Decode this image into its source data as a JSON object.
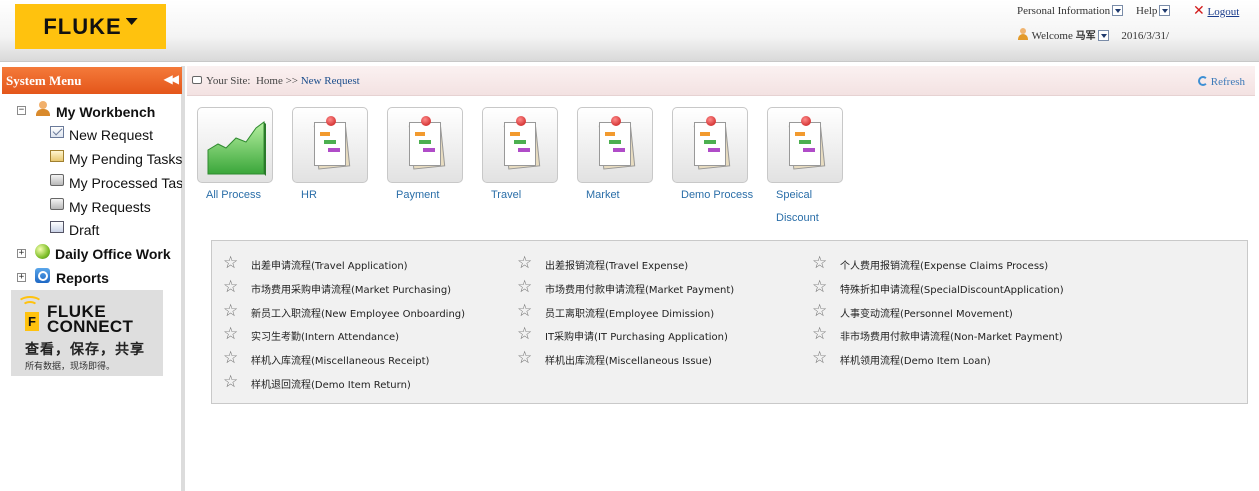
{
  "header": {
    "logo_text": "FLUKE",
    "personal_info": "Personal Information",
    "help": "Help",
    "logout": "Logout",
    "welcome": "Welcome",
    "username": "马军",
    "date": "2016/3/31/"
  },
  "sidebar": {
    "title": "System Menu",
    "tree": [
      {
        "label": "My Workbench",
        "expanded": true,
        "children": [
          {
            "label": "New Request"
          },
          {
            "label": "My Pending Tasks"
          },
          {
            "label": "My Processed Tasks"
          },
          {
            "label": "My Requests"
          },
          {
            "label": "Draft"
          }
        ]
      },
      {
        "label": "Daily Office Work",
        "expanded": false
      },
      {
        "label": "Reports",
        "expanded": false
      }
    ],
    "toggle_expanded": "−",
    "toggle_collapsed": "+",
    "ad": {
      "line1": "FLUKE",
      "line2": "CONNECT",
      "slogan": "查看，保存，共享",
      "subtext": "所有数据，现场即得。",
      "badge": "F"
    }
  },
  "breadcrumb": {
    "prefix": "Your Site:",
    "home": "Home >>",
    "current": "New Request",
    "refresh": "Refresh"
  },
  "tiles": [
    {
      "label": "All Process"
    },
    {
      "label": "HR"
    },
    {
      "label": "Payment"
    },
    {
      "label": "Travel"
    },
    {
      "label": "Market"
    },
    {
      "label": "Demo Process"
    },
    {
      "label": "Speical",
      "label2": "Discount"
    }
  ],
  "processes": [
    [
      "出差申请流程(Travel Application)",
      "出差报销流程(Travel Expense)",
      "个人费用报销流程(Expense Claims Process)"
    ],
    [
      "市场费用采购申请流程(Market Purchasing)",
      "市场费用付款申请流程(Market Payment)",
      "特殊折扣申请流程(SpecialDiscountApplication)"
    ],
    [
      "新员工入职流程(New Employee Onboarding)",
      "员工离职流程(Employee Dimission)",
      "人事变动流程(Personnel Movement)"
    ],
    [
      "实习生考勤(Intern Attendance)",
      "IT采购申请(IT Purchasing Application)",
      "非市场费用付款申请流程(Non-Market Payment)"
    ],
    [
      "样机入库流程(Miscellaneous Receipt)",
      "样机出库流程(Miscellaneous Issue)",
      "样机领用流程(Demo Item Loan)"
    ],
    [
      "样机退回流程(Demo Item Return)"
    ]
  ],
  "icons": {
    "star": "☆",
    "logout_x": "✕",
    "collapse": "◀◀"
  },
  "colors": {
    "brand": "#ffc20e",
    "menu_header": "#f05a1e",
    "link": "#2a6ea8"
  }
}
